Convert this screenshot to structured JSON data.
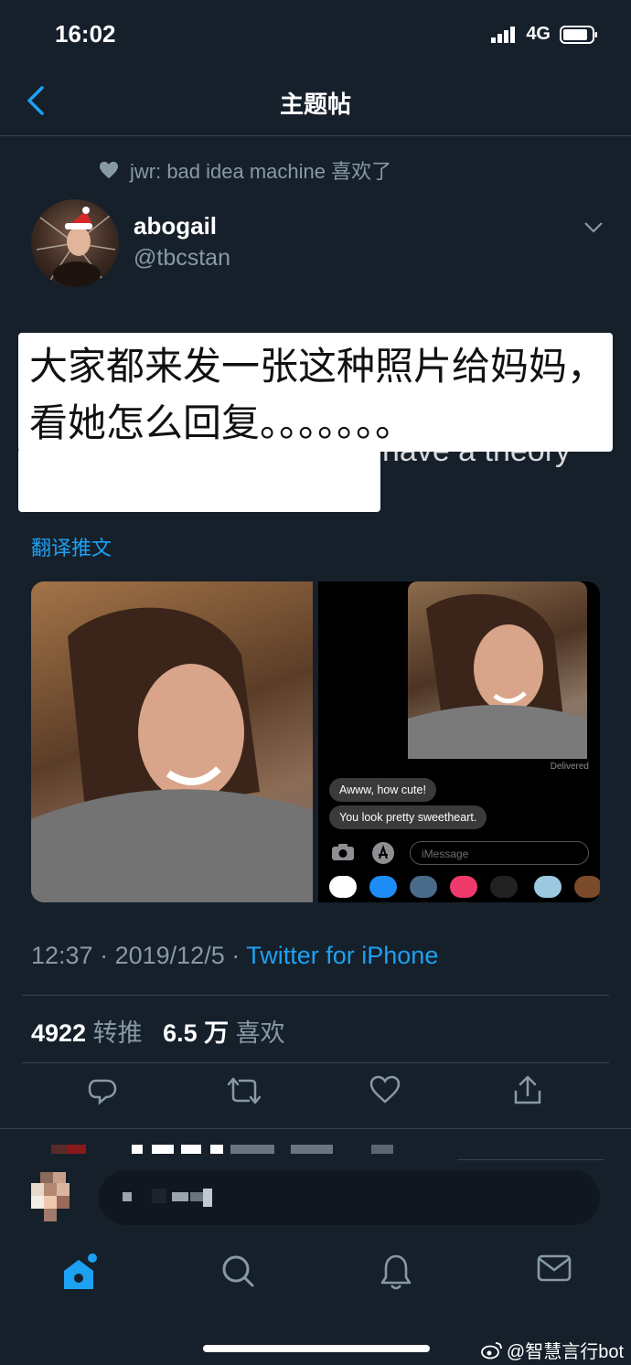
{
  "status_bar": {
    "time": "16:02",
    "network": "4G"
  },
  "nav": {
    "title": "主题帖"
  },
  "social_context": {
    "text": "jwr: bad idea machine 喜欢了"
  },
  "author": {
    "name": "abogail",
    "handle": "@tbcstan"
  },
  "tweet": {
    "hidden_text_fragment": "have a theory",
    "overlay_caption": "大家都来发一张这种照片给妈妈，看她怎么回复。。。。。。。",
    "translate_link": "翻译推文"
  },
  "media": {
    "screenshot_messages": [
      "Awww, how cute!",
      "You look pretty sweetheart."
    ],
    "delivered_label": "Delivered",
    "imessage_placeholder": "iMessage"
  },
  "meta": {
    "time": "12:37",
    "date": "2019/12/5",
    "source": "Twitter for iPhone"
  },
  "stats": {
    "retweets": "4922",
    "retweets_label": "转推",
    "likes": "6.5 万",
    "likes_label": "喜欢"
  },
  "watermark": {
    "text": "@智慧言行bot"
  },
  "colors": {
    "background": "#15202b",
    "accent": "#1da1f2",
    "secondary_text": "#8899a6"
  }
}
